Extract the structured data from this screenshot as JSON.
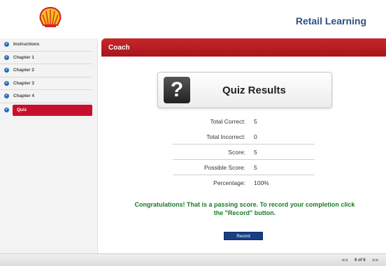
{
  "header": {
    "title": "Retail Learning",
    "logo_icon": "shell-logo-icon"
  },
  "sidebar": {
    "items": [
      {
        "label": "Instructions",
        "state": "complete"
      },
      {
        "label": "Chapter 1",
        "state": "complete"
      },
      {
        "label": "Chapter 2",
        "state": "complete"
      },
      {
        "label": "Chapter 3",
        "state": "complete"
      },
      {
        "label": "Chapter 4",
        "state": "complete"
      },
      {
        "label": "Quiz",
        "state": "active"
      }
    ]
  },
  "main": {
    "section_title": "Coach",
    "quiz_card": {
      "icon": "question-mark-icon",
      "icon_glyph": "?",
      "title": "Quiz Results"
    },
    "results": [
      {
        "label": "Total Correct:",
        "value": "5"
      },
      {
        "label": "Total Incorrect:",
        "value": "0"
      },
      {
        "label": "Score:",
        "value": "5"
      },
      {
        "label": "Possible Score:",
        "value": "5"
      },
      {
        "label": "Percentage:",
        "value": "100%"
      }
    ],
    "message": "Congratulations! That is a passing score. To record your completion click the \"Record\" button.",
    "record_button": "Record"
  },
  "footer": {
    "prev_icon": "rewind-icon",
    "next_icon": "fast-forward-icon",
    "page_indicator": "6 of 6",
    "prev_glyph": "◀◀",
    "next_glyph": "▶▶"
  },
  "colors": {
    "accent_red": "#c8102e",
    "brand_blue": "#2d4f86",
    "success_green": "#1b7a27",
    "button_navy": "#173f86"
  }
}
